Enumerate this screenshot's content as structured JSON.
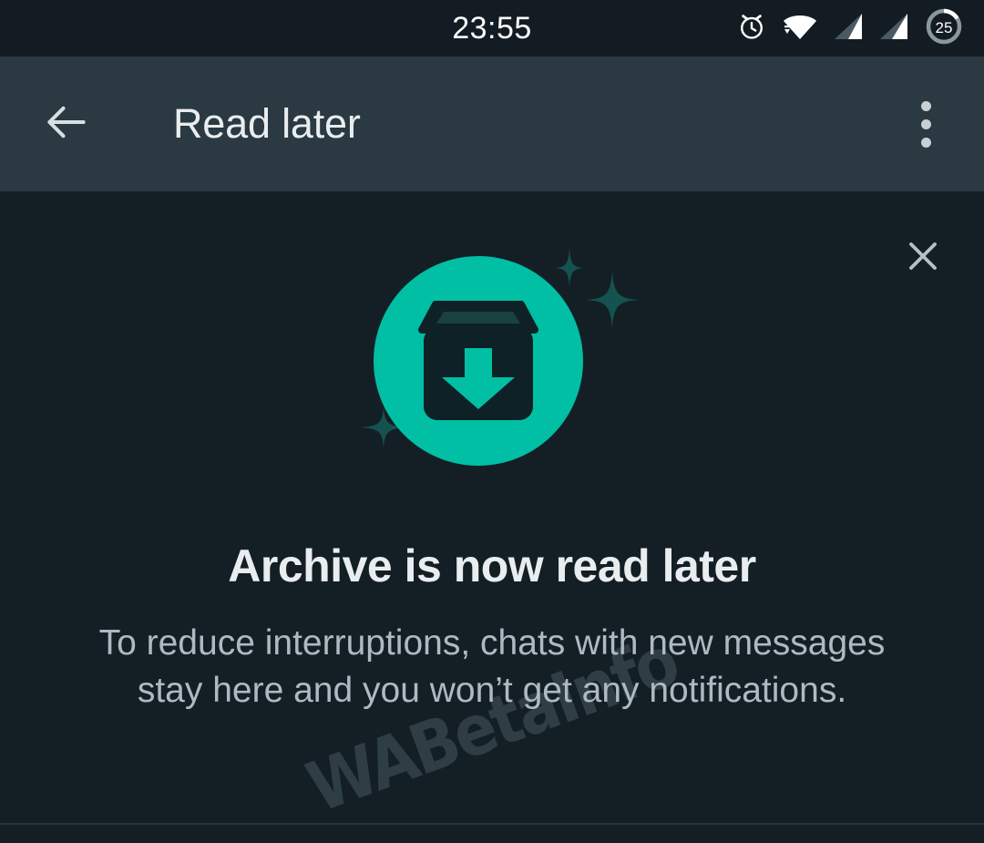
{
  "status_bar": {
    "time": "23:55",
    "battery_percent": "25",
    "icons": [
      "alarm-icon",
      "wifi-icon",
      "signal-1-icon",
      "signal-2-icon",
      "battery-circle-icon"
    ]
  },
  "app_bar": {
    "back_icon": "back-arrow-icon",
    "title": "Read later",
    "overflow_icon": "overflow-menu-icon"
  },
  "content": {
    "close_icon": "close-icon",
    "hero_icon": "archive-box-download-icon",
    "headline": "Archive is now read later",
    "body": "To reduce interruptions, chats with new messages stay here and you won’t get any notifications.",
    "watermark": "WABetaInfo"
  },
  "colors": {
    "status_bar_bg": "#131c22",
    "app_bar_bg": "#2a3942",
    "content_bg": "#131f25",
    "accent_teal": "#00bfa5",
    "icon_dark": "#0e2126",
    "primary_text": "#e9edef",
    "secondary_text": "#aebac1",
    "sparkle": "#14534f",
    "watermark": "#2f3d45"
  }
}
